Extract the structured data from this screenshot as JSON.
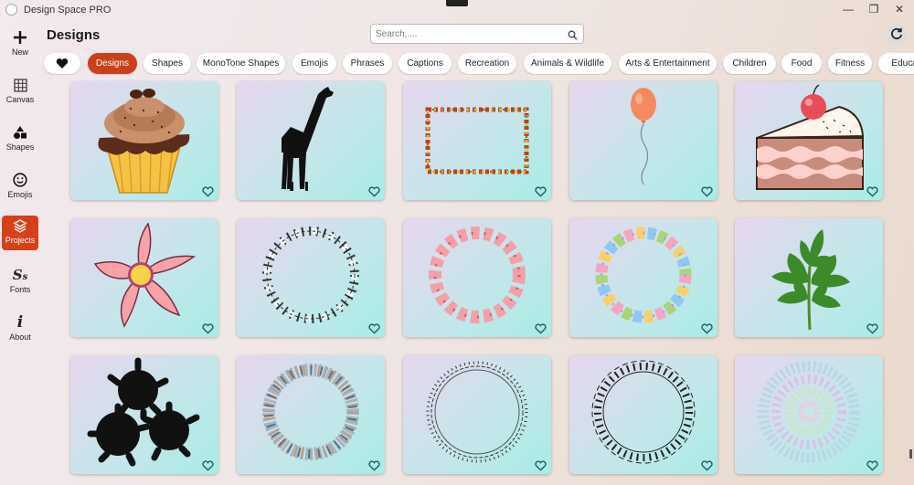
{
  "window": {
    "title": "Design Space PRO",
    "controls": {
      "minimize": "—",
      "maximize": "❐",
      "close": "✕"
    }
  },
  "sidebar": {
    "items": [
      {
        "label": "New",
        "icon": "plus-icon",
        "active": false
      },
      {
        "label": "Canvas",
        "icon": "grid-icon",
        "active": false
      },
      {
        "label": "Shapes",
        "icon": "shapes-icon",
        "active": false
      },
      {
        "label": "Emojis",
        "icon": "smiley-icon",
        "active": false
      },
      {
        "label": "Projects",
        "icon": "layers-icon",
        "active": true
      },
      {
        "label": "Fonts",
        "icon": "fonts-icon",
        "active": false
      },
      {
        "label": "About",
        "icon": "info-icon",
        "active": false
      }
    ]
  },
  "header": {
    "title": "Designs",
    "search_placeholder": "Search....."
  },
  "categories": [
    {
      "label": "",
      "icon": "heart-icon",
      "active": false
    },
    {
      "label": "Designs",
      "active": true
    },
    {
      "label": "Shapes",
      "active": false
    },
    {
      "label": "MonoTone Shapes",
      "active": false
    },
    {
      "label": "Emojis",
      "active": false
    },
    {
      "label": "Phrases",
      "active": false
    },
    {
      "label": "Captions",
      "active": false
    },
    {
      "label": "Recreation",
      "active": false
    },
    {
      "label": "Animals & Wildlife",
      "active": false
    },
    {
      "label": "Arts & Entertainment",
      "active": false
    },
    {
      "label": "Children",
      "active": false
    },
    {
      "label": "Food",
      "active": false
    },
    {
      "label": "Fitness",
      "active": false
    },
    {
      "label": "Educat",
      "active": false
    }
  ],
  "designs": [
    {
      "name": "cupcake",
      "favorited": false
    },
    {
      "name": "giraffe-silhouette",
      "favorited": false
    },
    {
      "name": "floral-frame",
      "favorited": false
    },
    {
      "name": "balloon",
      "favorited": false
    },
    {
      "name": "cake-slice",
      "favorited": false
    },
    {
      "name": "pink-flower",
      "favorited": false
    },
    {
      "name": "outline-star-wreath",
      "favorited": false
    },
    {
      "name": "pink-star-wreath",
      "favorited": false
    },
    {
      "name": "rainbow-star-wreath",
      "favorited": false
    },
    {
      "name": "cilantro-leaf",
      "favorited": false
    },
    {
      "name": "splat-blobs",
      "favorited": false
    },
    {
      "name": "people-wreath",
      "favorited": false
    },
    {
      "name": "music-note-ring",
      "favorited": false
    },
    {
      "name": "music-notes-frame",
      "favorited": false
    },
    {
      "name": "color-swirl",
      "favorited": false
    }
  ],
  "colors": {
    "accent": "#d8401a",
    "card_gradient_start": "#e8d6ef",
    "card_gradient_end": "#a8ece6"
  }
}
